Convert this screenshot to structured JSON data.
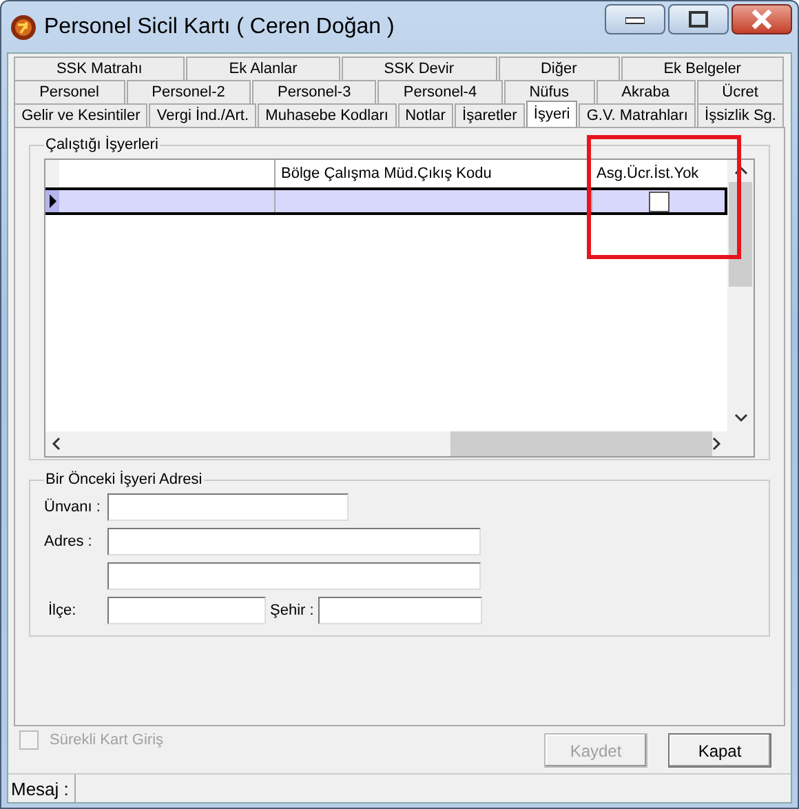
{
  "window": {
    "title": "Personel Sicil Kartı ( Ceren Doğan )"
  },
  "tab_rows": [
    [
      {
        "label": "SSK Matrahı",
        "selected": false
      },
      {
        "label": "Ek Alanlar",
        "selected": false
      },
      {
        "label": "SSK Devir",
        "selected": false
      },
      {
        "label": "Diğer",
        "selected": false
      },
      {
        "label": "Ek Belgeler",
        "selected": false
      }
    ],
    [
      {
        "label": "Personel",
        "selected": false
      },
      {
        "label": "Personel-2",
        "selected": false
      },
      {
        "label": "Personel-3",
        "selected": false
      },
      {
        "label": "Personel-4",
        "selected": false
      },
      {
        "label": "Nüfus",
        "selected": false
      },
      {
        "label": "Akraba",
        "selected": false
      },
      {
        "label": "Ücret",
        "selected": false
      }
    ],
    [
      {
        "label": "Gelir ve Kesintiler",
        "selected": false
      },
      {
        "label": "Vergi İnd./Art.",
        "selected": false
      },
      {
        "label": "Muhasebe Kodları",
        "selected": false
      },
      {
        "label": "Notlar",
        "selected": false
      },
      {
        "label": "İşaretler",
        "selected": false
      },
      {
        "label": "İşyeri",
        "selected": true
      },
      {
        "label": "G.V. Matrahları",
        "selected": false
      },
      {
        "label": "İşsizlik Sg.",
        "selected": false
      }
    ]
  ],
  "workplaces": {
    "title": "Çalıştığı İşyerleri",
    "columns": [
      "Bölge Çalışma Müd.Çıkış Kodu",
      "Asg.Ücr.İst.Yok"
    ],
    "rows": [
      {
        "selected": true,
        "checked": false
      }
    ]
  },
  "previous_address": {
    "title": "Bir Önceki İşyeri Adresi",
    "title_label": "Ünvanı :",
    "address_label": "Adres :",
    "district_label": "İlçe:",
    "city_label": "Şehir :"
  },
  "continuous_entry": {
    "label": "Sürekli Kart Giriş",
    "checked": false,
    "disabled": true
  },
  "buttons": [
    {
      "label": "Kaydet",
      "disabled": true
    },
    {
      "label": "Kapat",
      "disabled": false
    }
  ],
  "status_bar": {
    "label": "Mesaj :"
  }
}
